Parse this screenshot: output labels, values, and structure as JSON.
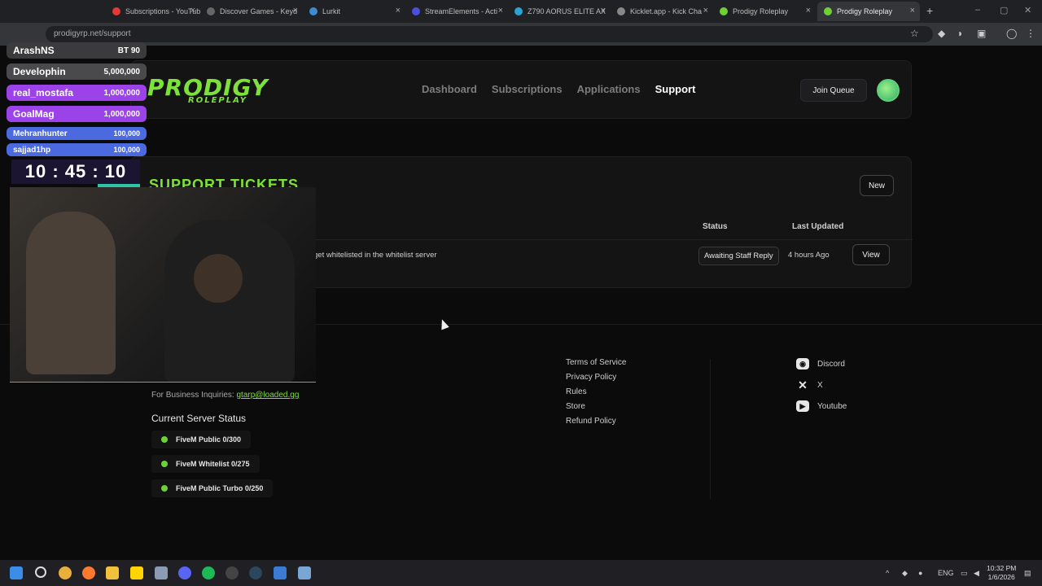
{
  "browser": {
    "tabs": [
      {
        "label": "Subscriptions - YouTube"
      },
      {
        "label": "Discover Games - Keyd"
      },
      {
        "label": "Lurkit"
      },
      {
        "label": "StreamElements - Acti"
      },
      {
        "label": "Z790 AORUS ELITE AX"
      },
      {
        "label": "Kicklet.app - Kick Cha"
      },
      {
        "label": "Prodigy Roleplay"
      },
      {
        "label": "Prodigy Roleplay"
      }
    ],
    "url": "prodigyrp.net/support",
    "new_tab": "+"
  },
  "header": {
    "logo": "PRODIGY",
    "logo_sub": "ROLEPLAY",
    "nav": [
      "Dashboard",
      "Subscriptions",
      "Applications",
      "Support"
    ],
    "join_queue": "Join Queue"
  },
  "tickets": {
    "title": "SUPPORT TICKETS",
    "new_label": "New",
    "col_status": "Status",
    "col_updated": "Last Updated",
    "row": {
      "subject": "get whitelisted in the whitelist server",
      "status": "Awaiting Staff Reply",
      "updated": "4 hours Ago",
      "view": "View"
    }
  },
  "footer": {
    "business_label": "For Business Inquiries:",
    "business_email": "gtarp@loaded.gg",
    "server_status_title": "Current Server Status",
    "servers": [
      "FiveM Public 0/300",
      "FiveM Whitelist 0/275",
      "FiveM Public Turbo 0/250"
    ],
    "links": [
      "Terms of Service",
      "Privacy Policy",
      "Rules",
      "Store",
      "Refund Policy"
    ],
    "social": [
      "Discord",
      "X",
      "Youtube"
    ]
  },
  "overlay": {
    "leaderboard": [
      {
        "name": "ArashNS",
        "value": "BT 90"
      },
      {
        "name": "Develophin",
        "value": "5,000,000"
      },
      {
        "name": "real_mostafa",
        "value": "1,000,000"
      },
      {
        "name": "GoalMag",
        "value": "1,000,000"
      },
      {
        "name": "Mehranhunter",
        "value": "100,000"
      },
      {
        "name": "sajjad1hp",
        "value": "100,000"
      }
    ],
    "timer": "10 : 45 : 10"
  },
  "taskbar": {
    "lang": "ENG",
    "time": "10:32 PM",
    "date": "1/6/2026"
  }
}
